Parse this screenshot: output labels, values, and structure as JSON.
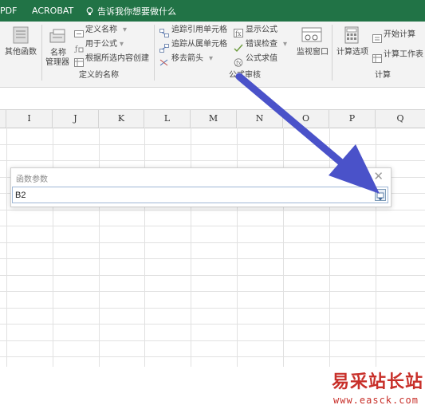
{
  "tabs": {
    "pdf": "PDF",
    "acrobat": "ACROBAT",
    "tell_me": "告诉我你想要做什么"
  },
  "ribbon": {
    "other_functions": "其他函数",
    "name_manager_line1": "名称",
    "name_manager_line2": "管理器",
    "define_name": "定义名称",
    "use_in_formula": "用于公式",
    "create_from_selection": "根据所选内容创建",
    "group_defined_names": "定义的名称",
    "trace_precedents": "追踪引用单元格",
    "trace_dependents": "追踪从属单元格",
    "remove_arrows": "移去箭头",
    "show_formulas": "显示公式",
    "error_checking": "错误检查",
    "evaluate_formula": "公式求值",
    "group_formula_auditing": "公式审核",
    "watch_window": "监视窗口",
    "calc_options": "计算选项",
    "calc_now": "开始计算",
    "calc_sheet": "计算工作表",
    "group_calculation": "计算"
  },
  "columns": [
    "I",
    "J",
    "K",
    "L",
    "M",
    "N",
    "O",
    "P",
    "Q"
  ],
  "dialog": {
    "title": "函数参数",
    "value": "B2",
    "close_glyph": "✕"
  },
  "watermark": {
    "line1": "易采站长站",
    "line2": "www.easck.com"
  },
  "colors": {
    "accent_green": "#217346",
    "arrow_blue": "#4a52c9",
    "watermark_red": "#c8302a"
  }
}
